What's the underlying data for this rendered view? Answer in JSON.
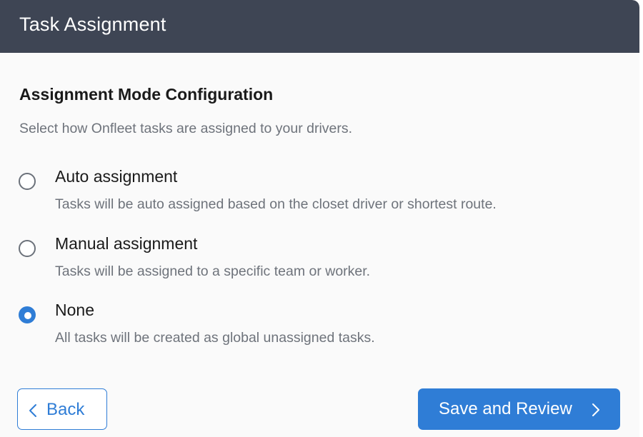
{
  "header": {
    "title": "Task Assignment"
  },
  "section": {
    "title": "Assignment Mode Configuration",
    "description": "Select how Onfleet tasks are assigned to your drivers."
  },
  "options": [
    {
      "label": "Auto assignment",
      "description": "Tasks will be auto assigned based on the closet driver or shortest route.",
      "selected": false
    },
    {
      "label": "Manual assignment",
      "description": "Tasks will be assigned to a specific team or worker.",
      "selected": false
    },
    {
      "label": "None",
      "description": "All tasks will be created as global unassigned tasks.",
      "selected": true
    }
  ],
  "footer": {
    "back_label": "Back",
    "back_icon": "chevron-left-icon",
    "save_label": "Save and Review",
    "save_icon": "chevron-right-icon"
  },
  "colors": {
    "header_bg": "#3e4554",
    "accent": "#2f7dd6",
    "muted_text": "#6e737b"
  }
}
